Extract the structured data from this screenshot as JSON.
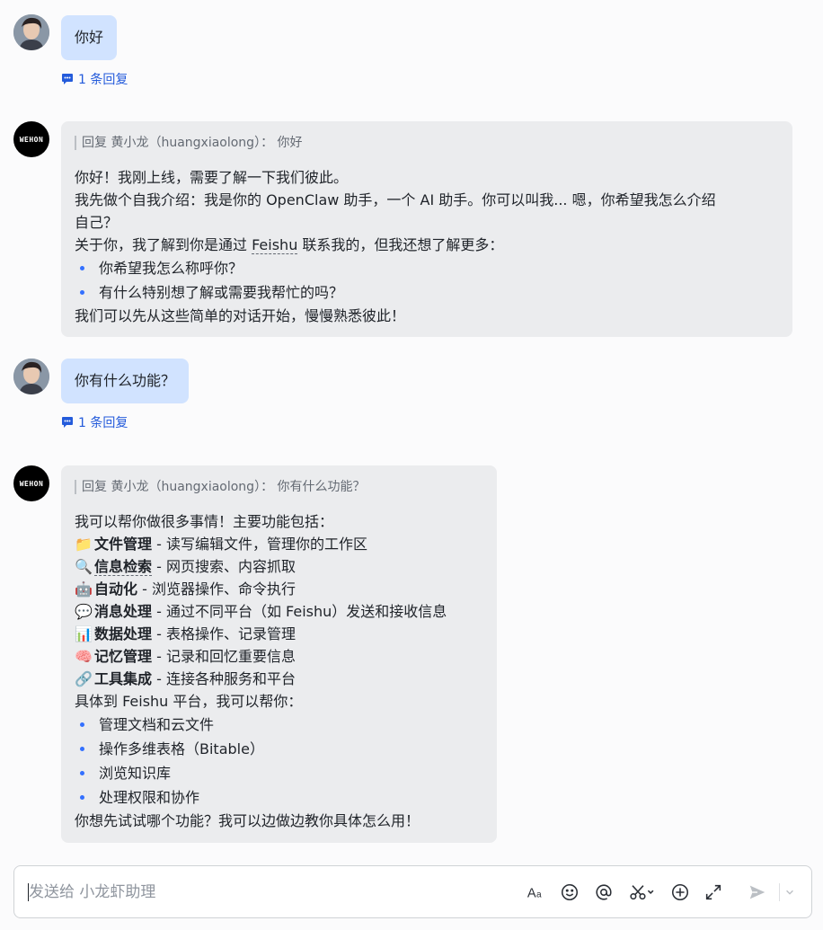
{
  "messages": {
    "m1": {
      "text": "你好",
      "reply_count": "1 条回复"
    },
    "m2": {
      "quote": "回复 黄小龙（huangxiaolong）： 你好",
      "l1": "你好！我刚上线，需要了解一下我们彼此。",
      "l2": "我先做个自我介绍：我是你的 OpenClaw 助手，一个 AI 助手。你可以叫我... 嗯，你希望我怎么介绍",
      "l3": "自己？",
      "l4a": "关于你，我了解到你是通过 ",
      "l4b": "Feishu",
      "l4c": " 联系我的，但我还想了解更多：",
      "b1": "你希望我怎么称呼你？",
      "b2": "有什么特别想了解或需要我帮忙的吗？",
      "l5": "我们可以先从这些简单的对话开始，慢慢熟悉彼此！"
    },
    "m3": {
      "text": "你有什么功能？",
      "reply_count": "1 条回复"
    },
    "m4": {
      "quote": "回复 黄小龙（huangxiaolong）： 你有什么功能？",
      "intro": "我可以帮你做很多事情！主要功能包括：",
      "features": [
        {
          "emoji": "📁",
          "name": "文件管理",
          "desc": " - 读写编辑文件，管理你的工作区"
        },
        {
          "emoji": "🔍",
          "name": "信息检索",
          "desc": " - 网页搜索、内容抓取"
        },
        {
          "emoji": "🤖",
          "name": "自动化",
          "desc": " - 浏览器操作、命令执行"
        },
        {
          "emoji": "💬",
          "name": "消息处理",
          "desc": " - 通过不同平台（如 Feishu）发送和接收信息"
        },
        {
          "emoji": "📊",
          "name": "数据处理",
          "desc": " - 表格操作、记录管理"
        },
        {
          "emoji": "🧠",
          "name": "记忆管理",
          "desc": " - 记录和回忆重要信息"
        },
        {
          "emoji": "🔗",
          "name": "工具集成",
          "desc": " - 连接各种服务和平台"
        }
      ],
      "platform": "具体到 Feishu 平台，我可以帮你：",
      "bullets": [
        "管理文档和云文件",
        "操作多维表格（Bitable）",
        "浏览知识库",
        "处理权限和协作"
      ],
      "outro": "你想先试试哪个功能？我可以边做边教你具体怎么用！"
    }
  },
  "bot_logo": "WEHON",
  "composer": {
    "placeholder": "发送给 小龙虾助理",
    "icons": [
      "text-format-icon",
      "emoji-icon",
      "mention-icon",
      "scissors-icon",
      "add-icon",
      "expand-icon",
      "send-icon",
      "chevron-down-icon"
    ]
  },
  "colors": {
    "user_bubble": "#d1e3ff",
    "bot_bubble": "#ebecee",
    "link": "#245bdb",
    "bullet": "#3370ff"
  }
}
